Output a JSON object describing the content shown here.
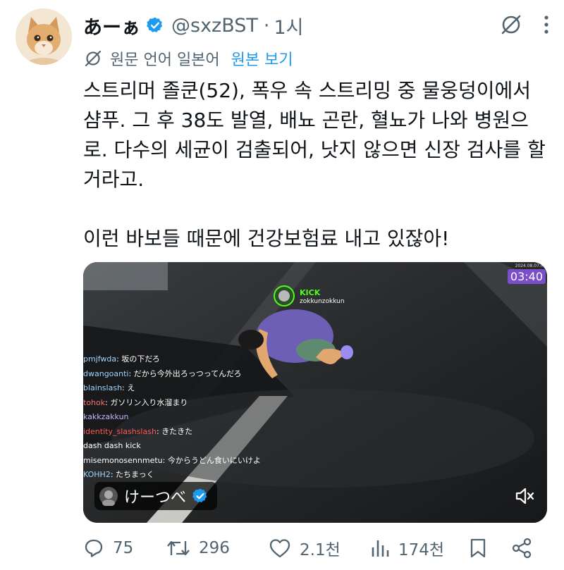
{
  "author": {
    "name": "あーぁ",
    "handle": "@sxzBST",
    "separator": "·",
    "time": "1시"
  },
  "translate": {
    "label": "원문 언어 일본어",
    "show_original": "원본 보기"
  },
  "tweet": {
    "text": "스트리머 졸쿤(52), 폭우 속 스트리밍 중 물웅덩이에서 샴푸. 그 후 38도 발열, 배뇨 곤란, 혈뇨가 나와 병원으로. 다수의 세균이 검출되어, 낫지 않으면 신장 검사를 할 거라고.\n\n이런 바보들 때문에 건강보험료 내고 있잖아!"
  },
  "media": {
    "timer": "03:40",
    "timestamp": "2024.08.07.M",
    "kick_brand": "KICK",
    "streamer": "zokkunzokkun",
    "overlay_name": "けーつべ",
    "chat": [
      {
        "user": "pmjfwda",
        "message": "坂の下だろ"
      },
      {
        "user": "dwangoanti",
        "message": "だから今外出ろっつってんだろ"
      },
      {
        "user": "blainslash",
        "message": "え"
      },
      {
        "user": "tohok",
        "message": "ガソリン入り水溜まり"
      },
      {
        "user": "kakkzakkun",
        "message": ""
      },
      {
        "user": "identity_slashslash",
        "message": "きたきた"
      },
      {
        "user": "dash dash kick",
        "message": ""
      },
      {
        "user": "misemonosennmetu",
        "message": "今からうどん食いにいけよ"
      },
      {
        "user": "KOHH2",
        "message": "たちまっく"
      }
    ]
  },
  "actions": {
    "replies": "75",
    "reposts": "296",
    "likes": "2.1천",
    "views": "174천"
  },
  "colors": {
    "text": "#0f1419",
    "secondary": "#536471",
    "accent": "#1d9bf0",
    "kick_green": "#53fc18",
    "timer_purple": "#7b4fc9"
  }
}
